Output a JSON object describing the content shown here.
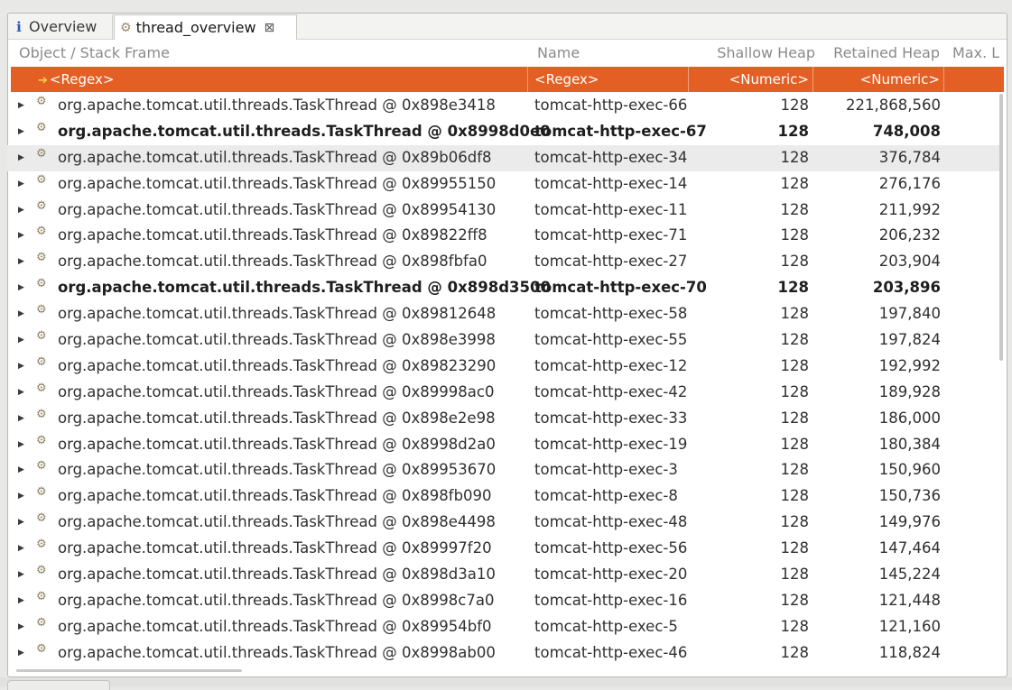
{
  "tabs": [
    {
      "label": "Overview",
      "icon": "info-icon"
    },
    {
      "label": "thread_overview",
      "icon": "gear-icon",
      "close": "⊠"
    }
  ],
  "columns": [
    "Object / Stack Frame",
    "Name",
    "Shallow Heap",
    "Retained Heap",
    "Max. L"
  ],
  "filter": {
    "object": "<Regex>",
    "name": "<Regex>",
    "shallow": "<Numeric>",
    "retained": "<Numeric>"
  },
  "rows": [
    {
      "object": "org.apache.tomcat.util.threads.TaskThread @ 0x898e3418",
      "name": "tomcat-http-exec-66",
      "shallow": "128",
      "retained": "221,868,560",
      "bold": false,
      "selected": false
    },
    {
      "object": "org.apache.tomcat.util.threads.TaskThread @ 0x8998d0e0",
      "name": "tomcat-http-exec-67",
      "shallow": "128",
      "retained": "748,008",
      "bold": true,
      "selected": false
    },
    {
      "object": "org.apache.tomcat.util.threads.TaskThread @ 0x89b06df8",
      "name": "tomcat-http-exec-34",
      "shallow": "128",
      "retained": "376,784",
      "bold": false,
      "selected": true
    },
    {
      "object": "org.apache.tomcat.util.threads.TaskThread @ 0x89955150",
      "name": "tomcat-http-exec-14",
      "shallow": "128",
      "retained": "276,176",
      "bold": false,
      "selected": false
    },
    {
      "object": "org.apache.tomcat.util.threads.TaskThread @ 0x89954130",
      "name": "tomcat-http-exec-11",
      "shallow": "128",
      "retained": "211,992",
      "bold": false,
      "selected": false
    },
    {
      "object": "org.apache.tomcat.util.threads.TaskThread @ 0x89822ff8",
      "name": "tomcat-http-exec-71",
      "shallow": "128",
      "retained": "206,232",
      "bold": false,
      "selected": false
    },
    {
      "object": "org.apache.tomcat.util.threads.TaskThread @ 0x898fbfa0",
      "name": "tomcat-http-exec-27",
      "shallow": "128",
      "retained": "203,904",
      "bold": false,
      "selected": false
    },
    {
      "object": "org.apache.tomcat.util.threads.TaskThread @ 0x898d3500",
      "name": "tomcat-http-exec-70",
      "shallow": "128",
      "retained": "203,896",
      "bold": true,
      "selected": false
    },
    {
      "object": "org.apache.tomcat.util.threads.TaskThread @ 0x89812648",
      "name": "tomcat-http-exec-58",
      "shallow": "128",
      "retained": "197,840",
      "bold": false,
      "selected": false
    },
    {
      "object": "org.apache.tomcat.util.threads.TaskThread @ 0x898e3998",
      "name": "tomcat-http-exec-55",
      "shallow": "128",
      "retained": "197,824",
      "bold": false,
      "selected": false
    },
    {
      "object": "org.apache.tomcat.util.threads.TaskThread @ 0x89823290",
      "name": "tomcat-http-exec-12",
      "shallow": "128",
      "retained": "192,992",
      "bold": false,
      "selected": false
    },
    {
      "object": "org.apache.tomcat.util.threads.TaskThread @ 0x89998ac0",
      "name": "tomcat-http-exec-42",
      "shallow": "128",
      "retained": "189,928",
      "bold": false,
      "selected": false
    },
    {
      "object": "org.apache.tomcat.util.threads.TaskThread @ 0x898e2e98",
      "name": "tomcat-http-exec-33",
      "shallow": "128",
      "retained": "186,000",
      "bold": false,
      "selected": false
    },
    {
      "object": "org.apache.tomcat.util.threads.TaskThread @ 0x8998d2a0",
      "name": "tomcat-http-exec-19",
      "shallow": "128",
      "retained": "180,384",
      "bold": false,
      "selected": false
    },
    {
      "object": "org.apache.tomcat.util.threads.TaskThread @ 0x89953670",
      "name": "tomcat-http-exec-3",
      "shallow": "128",
      "retained": "150,960",
      "bold": false,
      "selected": false
    },
    {
      "object": "org.apache.tomcat.util.threads.TaskThread @ 0x898fb090",
      "name": "tomcat-http-exec-8",
      "shallow": "128",
      "retained": "150,736",
      "bold": false,
      "selected": false
    },
    {
      "object": "org.apache.tomcat.util.threads.TaskThread @ 0x898e4498",
      "name": "tomcat-http-exec-48",
      "shallow": "128",
      "retained": "149,976",
      "bold": false,
      "selected": false
    },
    {
      "object": "org.apache.tomcat.util.threads.TaskThread @ 0x89997f20",
      "name": "tomcat-http-exec-56",
      "shallow": "128",
      "retained": "147,464",
      "bold": false,
      "selected": false
    },
    {
      "object": "org.apache.tomcat.util.threads.TaskThread @ 0x898d3a10",
      "name": "tomcat-http-exec-20",
      "shallow": "128",
      "retained": "145,224",
      "bold": false,
      "selected": false
    },
    {
      "object": "org.apache.tomcat.util.threads.TaskThread @ 0x8998c7a0",
      "name": "tomcat-http-exec-16",
      "shallow": "128",
      "retained": "121,448",
      "bold": false,
      "selected": false
    },
    {
      "object": "org.apache.tomcat.util.threads.TaskThread @ 0x89954bf0",
      "name": "tomcat-http-exec-5",
      "shallow": "128",
      "retained": "121,160",
      "bold": false,
      "selected": false
    },
    {
      "object": "org.apache.tomcat.util.threads.TaskThread @ 0x8998ab00",
      "name": "tomcat-http-exec-46",
      "shallow": "128",
      "retained": "118,824",
      "bold": false,
      "selected": false
    }
  ],
  "colors": {
    "filter_bg": "#e35f24",
    "selected_row_bg": "#ebebeb"
  }
}
